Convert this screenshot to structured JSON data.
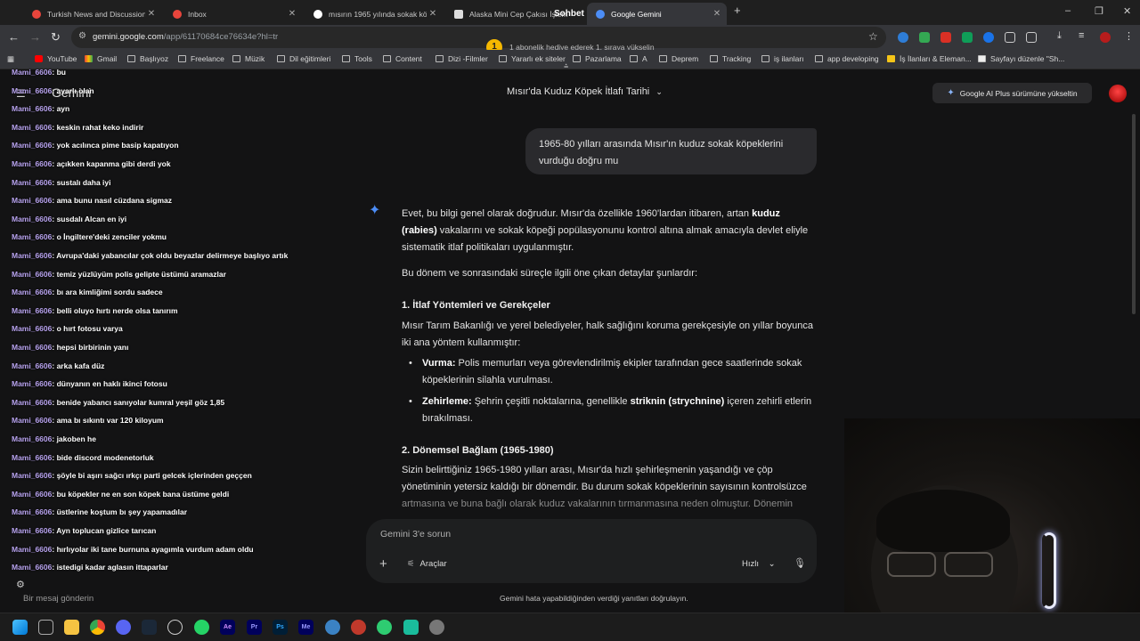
{
  "browser": {
    "tabs": [
      {
        "label": "Turkish News and Discussion",
        "color": "#e8453c",
        "active": false
      },
      {
        "label": "Inbox",
        "color": "#e8453c",
        "active": false
      },
      {
        "label": "mısırın 1965 yılında sokak köpe",
        "color": "#ffffff",
        "active": false
      },
      {
        "label": "Alaska Mini Cep Çakısı İşlem",
        "color": "#dddddd",
        "active": false
      },
      {
        "label": "Google Gemini",
        "color": "#4c8df6",
        "active": true
      }
    ],
    "new_tab": "+",
    "window_controls": {
      "minimize": "–",
      "restore": "❐",
      "close": "✕"
    },
    "url_host": "gemini.google.com",
    "url_path": "/app/61170684ce76634e?hl=tr",
    "bookmarks": [
      "YouTube",
      "Gmail",
      "Başlıyoz",
      "Freelance",
      "Müzik",
      "Dil eğitimleri",
      "Tools",
      "Content",
      "Dizi -Filmler",
      "Yararlı ek siteler",
      "Pazarlama",
      "A",
      "Deprem",
      "Tracking",
      "iş ilanları",
      "app developing",
      "İş İlanları & Eleman...",
      "Sayfayı düzenle \"Sh..."
    ]
  },
  "overlay": {
    "notification_count": "1",
    "notification_text": "1 abonelik hediye ederek 1. sıraya yükselin",
    "sohbet_label": "Sohbet",
    "chat_messages": [
      {
        "user": "Mami_6606",
        "text": "bu"
      },
      {
        "user": "Mami_6606",
        "text": "ayarlı olan"
      },
      {
        "user": "Mami_6606",
        "text": "ayn"
      },
      {
        "user": "Mami_6606",
        "text": "keskin rahat keko indirir"
      },
      {
        "user": "Mami_6606",
        "text": "yok acılınca pime basip kapatıyon"
      },
      {
        "user": "Mami_6606",
        "text": "açıkken kapanma gibi derdi yok"
      },
      {
        "user": "Mami_6606",
        "text": "sustalı daha iyi"
      },
      {
        "user": "Mami_6606",
        "text": "ama bunu nasıl cüzdana sigmaz"
      },
      {
        "user": "Mami_6606",
        "text": "susdalı Alcan en iyi"
      },
      {
        "user": "Mami_6606",
        "text": "o İngiltere'deki zenciler yokmu"
      },
      {
        "user": "Mami_6606",
        "text": "Avrupa'daki yabancılar çok oldu beyazlar delirmeye başlıyo artık"
      },
      {
        "user": "Mami_6606",
        "text": "temiz yüzlüyüm polis gelipte üstümü aramazlar"
      },
      {
        "user": "Mami_6606",
        "text": "bı ara kimliğimi sordu sadece"
      },
      {
        "user": "Mami_6606",
        "text": "belli oluyo hırtı nerde olsa tanırım"
      },
      {
        "user": "Mami_6606",
        "text": "o hırt fotosu varya"
      },
      {
        "user": "Mami_6606",
        "text": "hepsi birbirinin yanı"
      },
      {
        "user": "Mami_6606",
        "text": "arka kafa düz"
      },
      {
        "user": "Mami_6606",
        "text": "dünyanın en haklı ikinci fotosu"
      },
      {
        "user": "Mami_6606",
        "text": "benide yabancı sanıyolar kumral yeşil göz 1,85"
      },
      {
        "user": "Mami_6606",
        "text": "ama bı sıkıntı var 120 kiloyum"
      },
      {
        "user": "Mami_6606",
        "text": "jakoben he"
      },
      {
        "user": "Mami_6606",
        "text": "bide discord modenetorluk"
      },
      {
        "user": "Mami_6606",
        "text": "şöyle bi aşırı sağcı ırkçı parti gelcek içlerinden geççen"
      },
      {
        "user": "Mami_6606",
        "text": "bu köpekler ne en son köpek bana üstüme geldi"
      },
      {
        "user": "Mami_6606",
        "text": "üstlerine koştum bı şey yapamadılar"
      },
      {
        "user": "Mami_6606",
        "text": "Ayn toplucan gizlice tarıcan"
      },
      {
        "user": "Mami_6606",
        "text": "hırlıyolar iki tane burnuna ayagımla vurdum adam oldu"
      },
      {
        "user": "Mami_6606",
        "text": "istedigi kadar aglasın ittaparlar"
      }
    ],
    "chat_input_placeholder": "Bir mesaj gönderin"
  },
  "gemini": {
    "app_name": "Gemini",
    "conversation_title": "Mısır'da Kuduz Köpek İtlafı Tarihi",
    "upgrade_label": "Google AI Plus sürümüne yükseltin",
    "user_message": "1965-80 yılları arasında Mısır'ın kuduz sokak köpeklerini vurduğu doğru mu",
    "response": {
      "intro_1": "Evet, bu bilgi genel olarak doğrudur. Mısır'da özellikle 1960'lardan itibaren, artan ",
      "intro_bold": "kuduz (rabies)",
      "intro_2": " vakalarını ve sokak köpeği popülasyonunu kontrol altına almak amacıyla devlet eliyle sistematik itlaf politikaları uygulanmıştır.",
      "para2": "Bu dönem ve sonrasındaki süreçle ilgili öne çıkan detaylar şunlardır:",
      "h1": "1. İtlaf Yöntemleri ve Gerekçeler",
      "para3": "Mısır Tarım Bakanlığı ve yerel belediyeler, halk sağlığını koruma gerekçesiyle on yıllar boyunca iki ana yöntem kullanmıştır:",
      "b1_bold": "Vurma:",
      "b1_text": " Polis memurları veya görevlendirilmiş ekipler tarafından gece saatlerinde sokak köpeklerinin silahla vurulması.",
      "b2_bold": "Zehirleme:",
      "b2_text_1": " Şehrin çeşitli noktalarına, genellikle ",
      "b2_bold2": "striknin (strychnine)",
      "b2_text_2": " içeren zehirli etlerin bırakılması.",
      "h2": "2. Dönemsel Bağlam (1965-1980)",
      "para4": "Sizin belirttiğiniz 1965-1980 yılları arası, Mısır'da hızlı şehirleşmenin yaşandığı ve çöp yönetiminin yetersiz kaldığı bir dönemdir. Bu durum sokak köpeklerinin sayısının kontrolsüzce",
      "para4_fade": "artmasına ve buna bağlı olarak kuduz vakalarının tırmanmasına neden olmuştur. Dönemin"
    },
    "prompt_placeholder": "Gemini 3'e sorun",
    "tools_label": "Araçlar",
    "speed_label": "Hızlı",
    "disclaimer": "Gemini hata yapabildiğinden verdiği yanıtları doğrulayın."
  },
  "taskbar_icons": [
    "windows-start",
    "task-view",
    "chrome",
    "discord",
    "steam",
    "epic",
    "whatsapp",
    "Ae",
    "Pr",
    "Ps",
    "Me",
    "app1",
    "app2",
    "app3",
    "app4",
    "settings"
  ]
}
